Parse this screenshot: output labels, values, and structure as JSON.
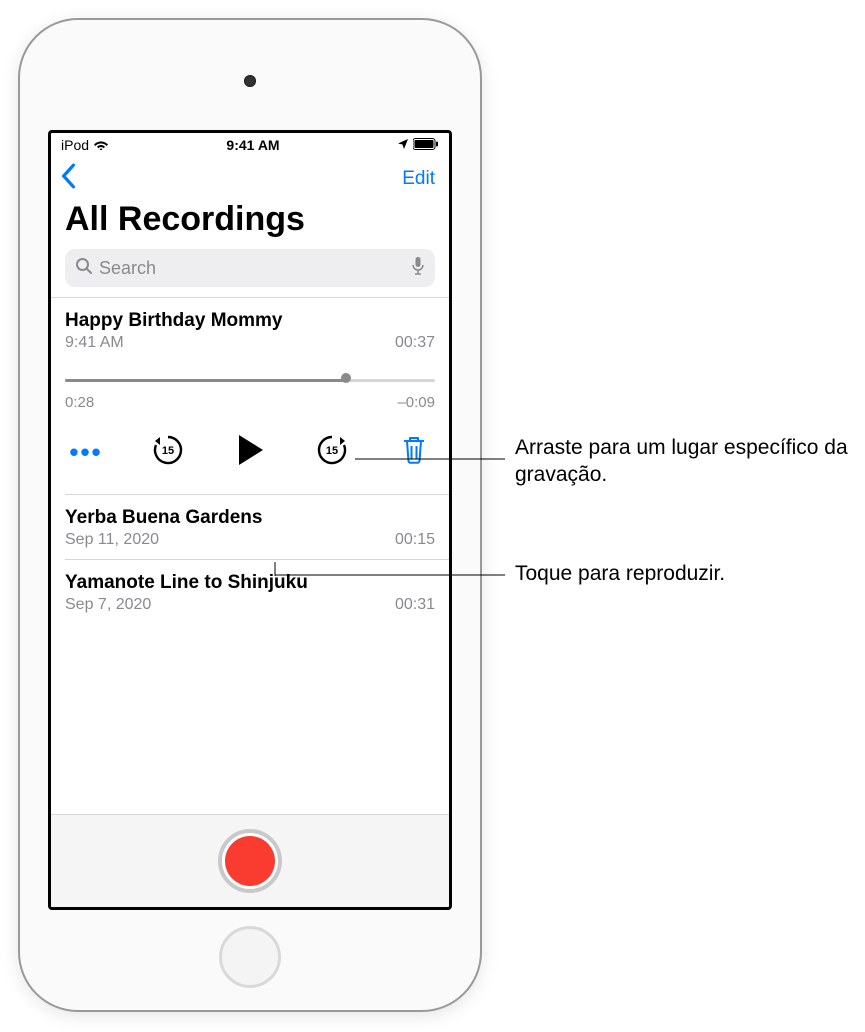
{
  "status": {
    "carrier": "iPod",
    "time": "9:41 AM"
  },
  "nav": {
    "edit_label": "Edit"
  },
  "page": {
    "title": "All Recordings"
  },
  "search": {
    "placeholder": "Search"
  },
  "recordings": [
    {
      "title": "Happy Birthday Mommy",
      "subtitle": "9:41 AM",
      "duration": "00:37",
      "expanded": true,
      "elapsed": "0:28",
      "remaining": "–0:09"
    },
    {
      "title": "Yerba Buena Gardens",
      "subtitle": "Sep 11, 2020",
      "duration": "00:15"
    },
    {
      "title": "Yamanote Line to Shinjuku",
      "subtitle": "Sep 7, 2020",
      "duration": "00:31"
    }
  ],
  "callouts": {
    "scrubber": "Arraste para um lugar específico da gravação.",
    "play": "Toque para reproduzir."
  }
}
